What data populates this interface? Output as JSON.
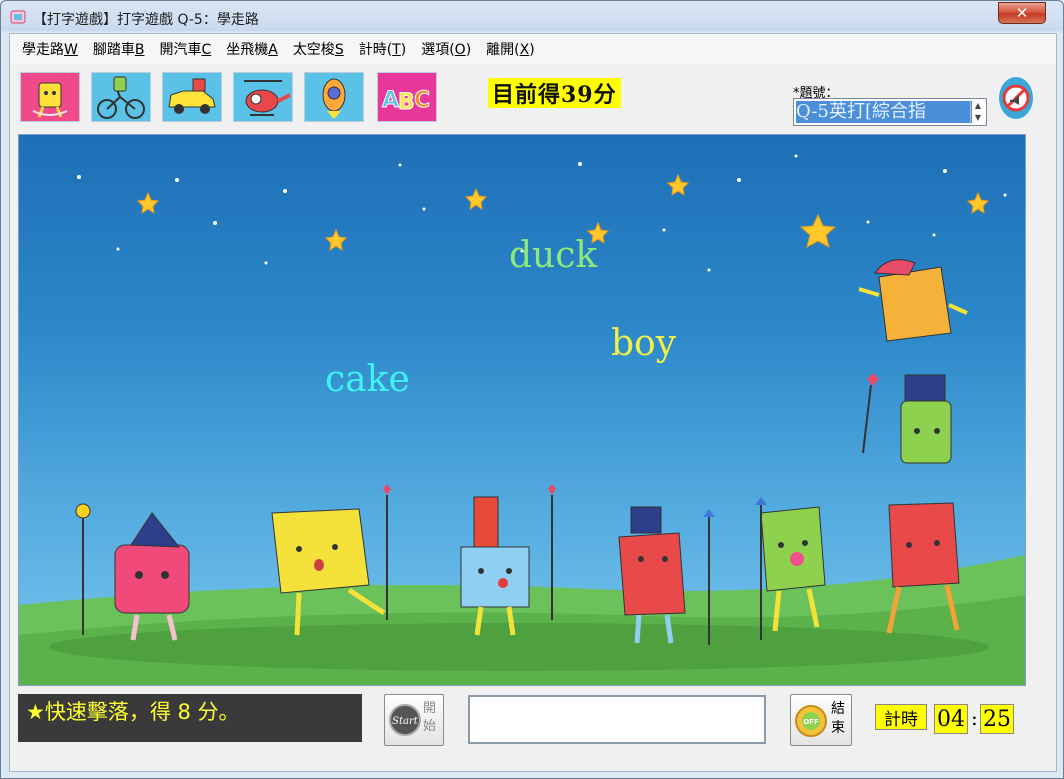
{
  "window": {
    "title": "【打字遊戲】打字遊戲 Q-5：學走路",
    "close_label": "✕"
  },
  "menu": [
    {
      "label": "學走路",
      "key": "W"
    },
    {
      "label": "腳踏車",
      "key": "B"
    },
    {
      "label": "開汽車",
      "key": "C"
    },
    {
      "label": "坐飛機",
      "key": "A"
    },
    {
      "label": "太空梭",
      "key": "S"
    },
    {
      "label": "計時(",
      "key": "T",
      "suffix": ")"
    },
    {
      "label": "選項(",
      "key": "O",
      "suffix": ")"
    },
    {
      "label": "離開(",
      "key": "X",
      "suffix": ")"
    }
  ],
  "toolbar": {
    "buttons": [
      {
        "icon": "walking-character-icon",
        "color": "#f04a8a"
      },
      {
        "icon": "bicycle-icon",
        "color": "#5bc2e7"
      },
      {
        "icon": "car-icon",
        "color": "#5bc2e7"
      },
      {
        "icon": "helicopter-icon",
        "color": "#5bc2e7"
      },
      {
        "icon": "rocket-icon",
        "color": "#5bc2e7"
      },
      {
        "icon": "abc-letters-icon",
        "color": "#e8379b"
      }
    ]
  },
  "score": {
    "text": "目前得39分"
  },
  "question": {
    "label": "*題號：",
    "value": "Q-5英打[綜合指"
  },
  "game": {
    "words": [
      {
        "text": "duck",
        "color": "#8fe87a"
      },
      {
        "text": "boy",
        "color": "#f0f048"
      },
      {
        "text": "cake",
        "color": "#3ef2f2"
      }
    ]
  },
  "status": {
    "message": "★快速擊落，得 8 分。"
  },
  "controls": {
    "start_icon_text": "Start",
    "start_label": "開\n始",
    "end_icon_text": "OFF",
    "end_label": "結\n束"
  },
  "input": {
    "value": ""
  },
  "timer": {
    "label": "計時",
    "minutes": "04",
    "seconds": "25"
  },
  "colors": {
    "highlight_yellow": "#ffff00",
    "sky_top": "#1e6fb6",
    "grass": "#5fb84f"
  }
}
